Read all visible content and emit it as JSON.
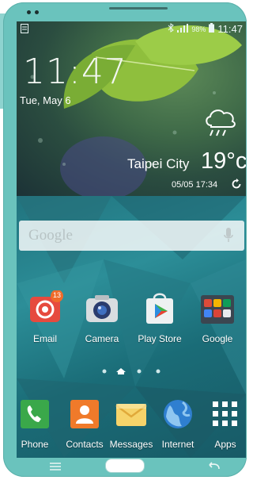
{
  "status_bar": {
    "battery_percent": "98%",
    "time": "11:47"
  },
  "lock_widget": {
    "clock": "11:47",
    "date": "Tue, May 6",
    "city": "Taipei City",
    "temperature": "19°c",
    "updated": "05/05 17:34",
    "weather": "cloud-rain"
  },
  "search": {
    "label": "Google"
  },
  "apps": [
    {
      "label": "Email",
      "icon": "email-icon",
      "badge": "13"
    },
    {
      "label": "Camera",
      "icon": "camera-icon"
    },
    {
      "label": "Play Store",
      "icon": "play-store-icon"
    },
    {
      "label": "Google",
      "icon": "google-folder-icon"
    }
  ],
  "pages": {
    "count": 4,
    "current": 2
  },
  "dock": [
    {
      "label": "Phone",
      "icon": "phone-icon"
    },
    {
      "label": "Contacts",
      "icon": "contacts-icon"
    },
    {
      "label": "Messages",
      "icon": "messages-icon"
    },
    {
      "label": "Internet",
      "icon": "internet-icon"
    },
    {
      "label": "Apps",
      "icon": "apps-grid-icon"
    }
  ],
  "colors": {
    "phone_body": "#6ac3bd",
    "accent": "#2c8e98"
  }
}
